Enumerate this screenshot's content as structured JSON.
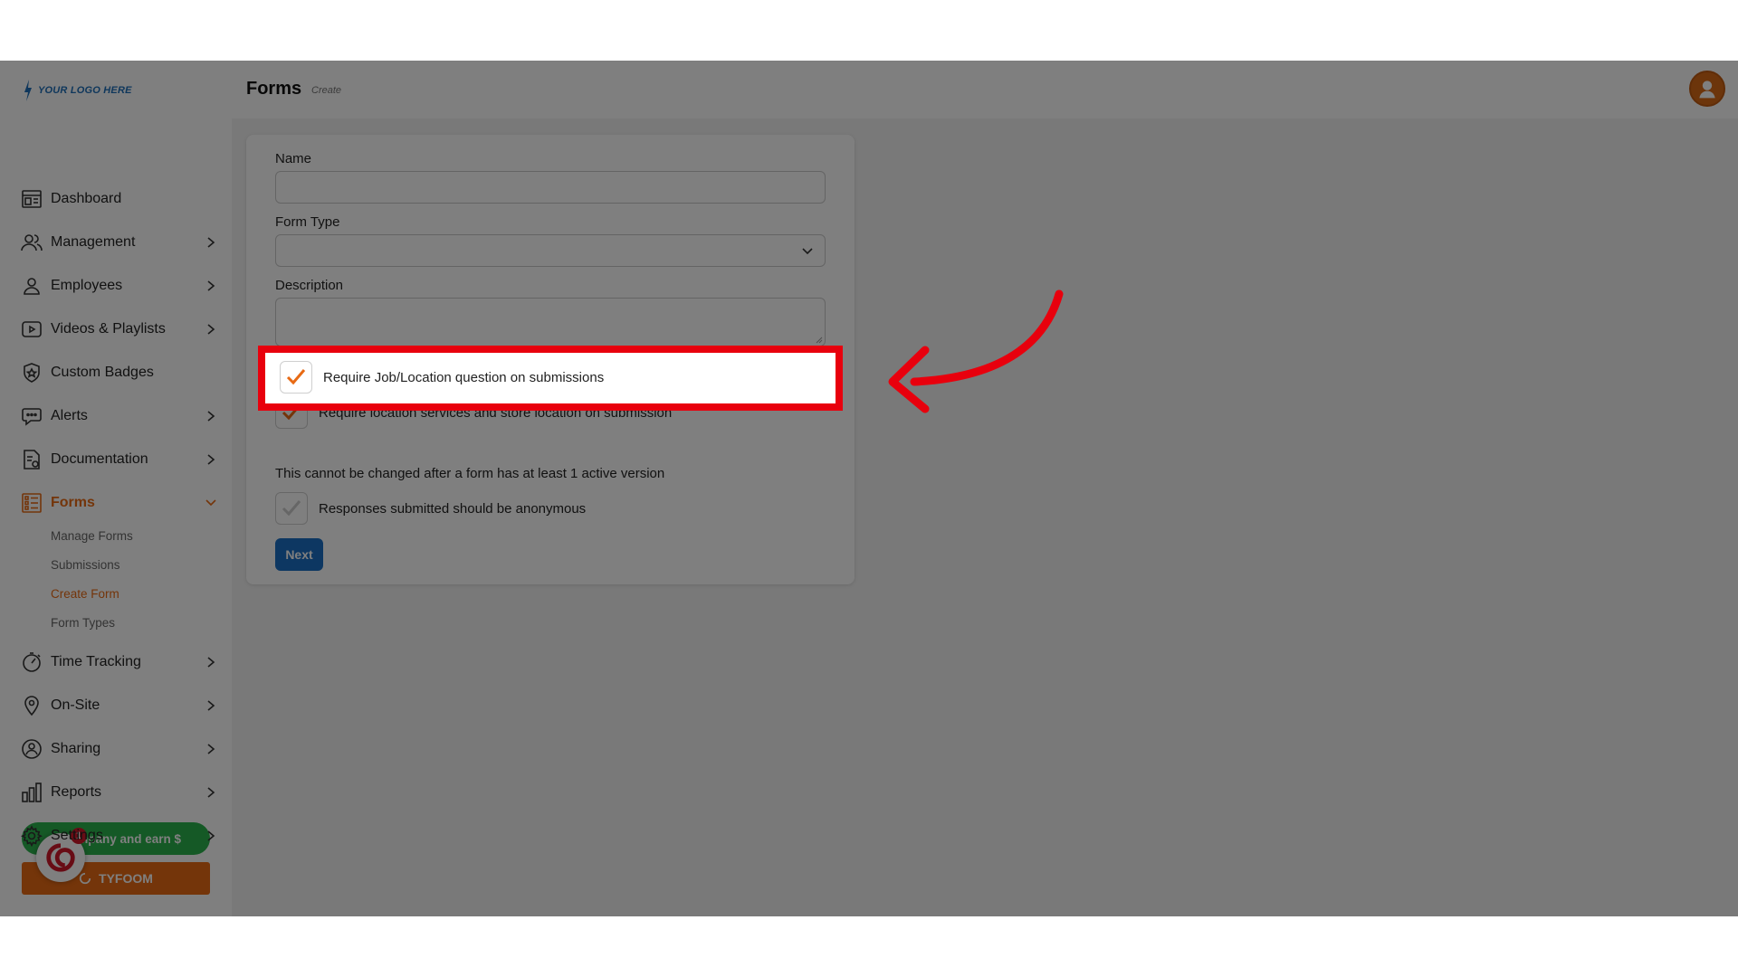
{
  "logo": {
    "text": "YOUR LOGO HERE"
  },
  "header": {
    "title": "Forms",
    "breadcrumb": "Create"
  },
  "sidebar": {
    "items": [
      {
        "label": "Dashboard",
        "icon": "dashboard-icon",
        "chevron": false
      },
      {
        "label": "Management",
        "icon": "management-icon",
        "chevron": true
      },
      {
        "label": "Employees",
        "icon": "employees-icon",
        "chevron": true
      },
      {
        "label": "Videos & Playlists",
        "icon": "video-icon",
        "chevron": true
      },
      {
        "label": "Custom Badges",
        "icon": "badge-icon",
        "chevron": false
      },
      {
        "label": "Alerts",
        "icon": "alerts-icon",
        "chevron": true
      },
      {
        "label": "Documentation",
        "icon": "documentation-icon",
        "chevron": true
      },
      {
        "label": "Forms",
        "icon": "forms-icon",
        "chevron": "down",
        "active": true
      },
      {
        "label": "Time Tracking",
        "icon": "timer-icon",
        "chevron": true
      },
      {
        "label": "On-Site",
        "icon": "location-pin-icon",
        "chevron": true
      },
      {
        "label": "Sharing",
        "icon": "sharing-icon",
        "chevron": true
      },
      {
        "label": "Reports",
        "icon": "reports-icon",
        "chevron": true
      },
      {
        "label": "Settings",
        "icon": "gear-icon",
        "chevron": true
      }
    ],
    "forms_sub": [
      "Manage Forms",
      "Submissions",
      "Create Form",
      "Form Types"
    ],
    "forms_sub_active": "Create Form",
    "refer_label": "Refer a company and earn $",
    "refer_visible": "Re ompany and earn $",
    "chat_badge": "1",
    "tyfoom_label": "TYFOOM"
  },
  "form": {
    "name_label": "Name",
    "name_value": "",
    "type_label": "Form Type",
    "type_value": "",
    "description_label": "Description",
    "description_value": "",
    "cb_job_location": {
      "label": "Require Job/Location question on submissions",
      "checked": true
    },
    "cb_location_services": {
      "label": "Require location services and store location on submission",
      "checked": true
    },
    "note": "This cannot be changed after a form has at least 1 active version",
    "cb_anonymous": {
      "label": "Responses submitted should be anonymous",
      "checked": false
    },
    "next_label": "Next"
  },
  "colors": {
    "accent_orange": "#e86a14",
    "primary_blue": "#1a6fc4",
    "highlight_red": "#e8000d",
    "refer_green": "#2bb24c"
  }
}
